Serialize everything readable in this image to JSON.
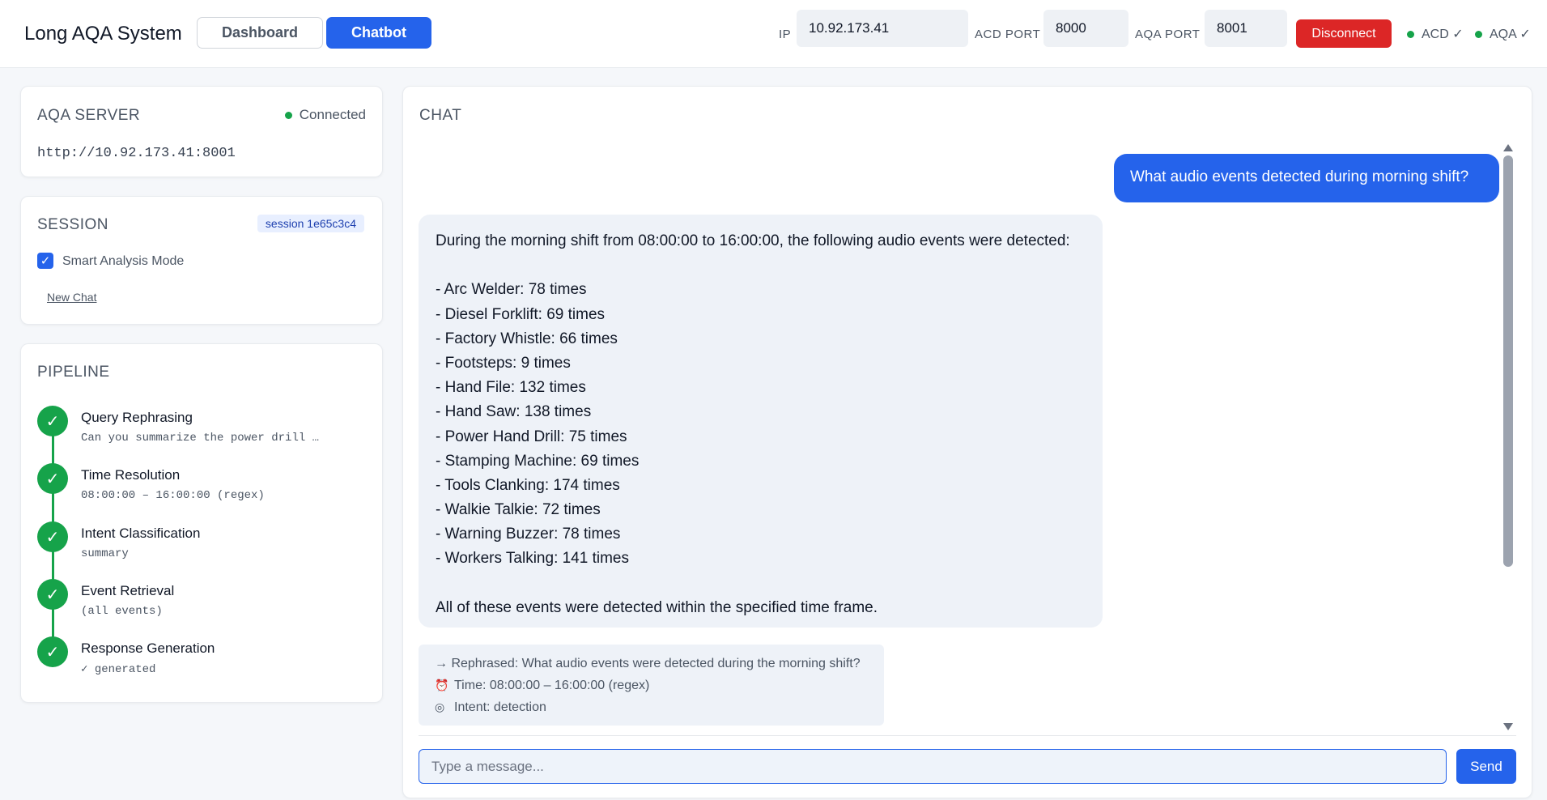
{
  "header": {
    "title": "Long AQA System",
    "tabs": [
      {
        "label": "Dashboard",
        "active": false
      },
      {
        "label": "Chatbot",
        "active": true
      }
    ],
    "ip_label": "IP",
    "ip_value": "10.92.173.41",
    "acd_port_label": "ACD PORT",
    "acd_port_value": "8000",
    "aqa_port_label": "AQA PORT",
    "aqa_port_value": "8001",
    "disconnect_label": "Disconnect",
    "status": [
      {
        "label": "ACD ✓",
        "color": "#16a34a"
      },
      {
        "label": "AQA ✓",
        "color": "#16a34a"
      }
    ]
  },
  "server_card": {
    "title": "AQA SERVER",
    "status": "Connected",
    "url": "http://10.92.173.41:8001"
  },
  "session_card": {
    "title": "SESSION",
    "session_id": "session 1e65c3c4",
    "smart_mode_label": "Smart Analysis Mode",
    "smart_mode_checked": true,
    "new_chat_label": "New Chat"
  },
  "pipeline_card": {
    "title": "PIPELINE",
    "steps": [
      {
        "name": "Query Rephrasing",
        "detail": "Can you summarize the power drill …",
        "icon": "check-icon"
      },
      {
        "name": "Time Resolution",
        "detail": "08:00:00 – 16:00:00 (regex)",
        "icon": "check-icon"
      },
      {
        "name": "Intent Classification",
        "detail": "summary",
        "icon": "check-icon"
      },
      {
        "name": "Event Retrieval",
        "detail": "(all events)",
        "icon": "check-icon"
      },
      {
        "name": "Response Generation",
        "detail": "✓ generated",
        "icon": "check-icon"
      }
    ]
  },
  "chat": {
    "title": "CHAT",
    "user_message": "What audio events detected during morning shift?",
    "bot_lines": [
      "During the morning shift from 08:00:00 to 16:00:00, the following audio events were detected:",
      "",
      "- Arc Welder: 78 times",
      "- Diesel Forklift: 69 times",
      "- Factory Whistle: 66 times",
      "- Footsteps: 9 times",
      "- Hand File: 132 times",
      "- Hand Saw: 138 times",
      "- Power Hand Drill: 75 times",
      "- Stamping Machine: 69 times",
      "- Tools Clanking: 174 times",
      "- Walkie Talkie: 72 times",
      "- Warning Buzzer: 78 times",
      "- Workers Talking: 141 times",
      "",
      "All of these events were detected within the specified time frame."
    ],
    "meta": {
      "rephrased": "→ Rephrased: What audio events were detected during the morning shift?",
      "time_icon": "alarm-clock-icon",
      "time": "Time: 08:00:00 – 16:00:00 (regex)",
      "intent_icon": "target-icon",
      "intent": "Intent: detection"
    },
    "input_placeholder": "Type a message...",
    "send_label": "Send"
  }
}
